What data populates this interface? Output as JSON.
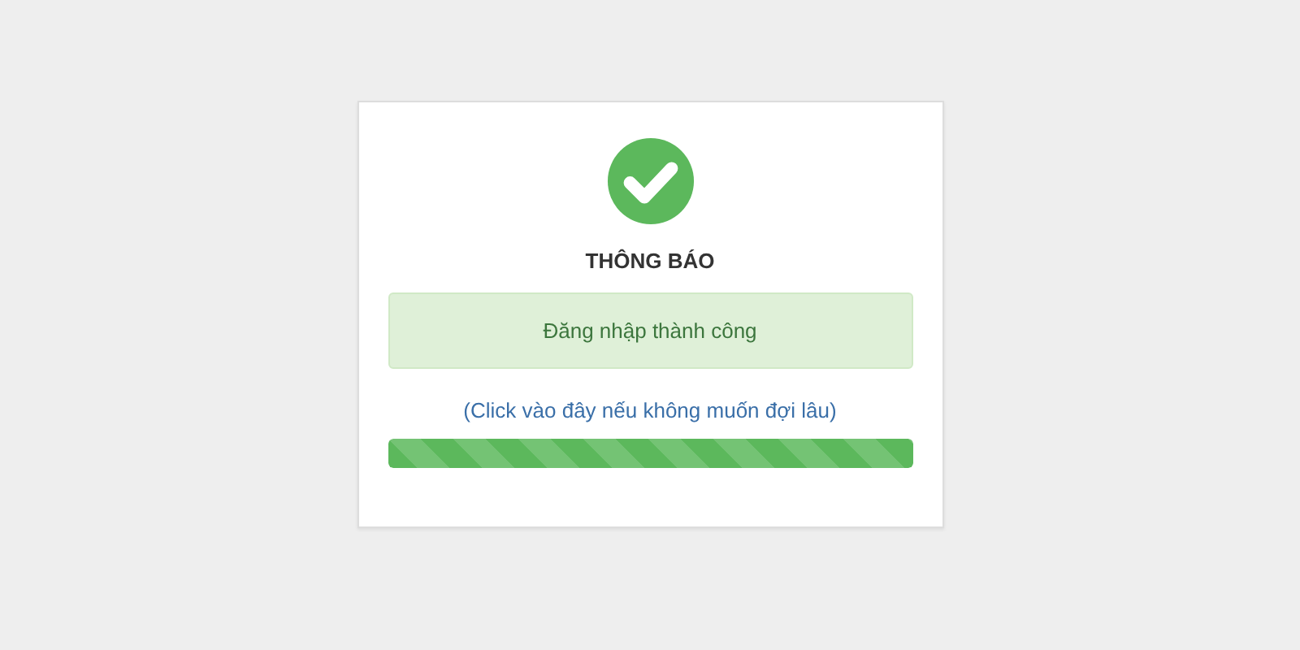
{
  "dialog": {
    "title": "THÔNG BÁO",
    "alert": {
      "message": "Đăng nhập thành công"
    },
    "link": "(Click vào đây nếu không muốn đợi lâu)",
    "progress": {
      "level": 1
    }
  }
}
